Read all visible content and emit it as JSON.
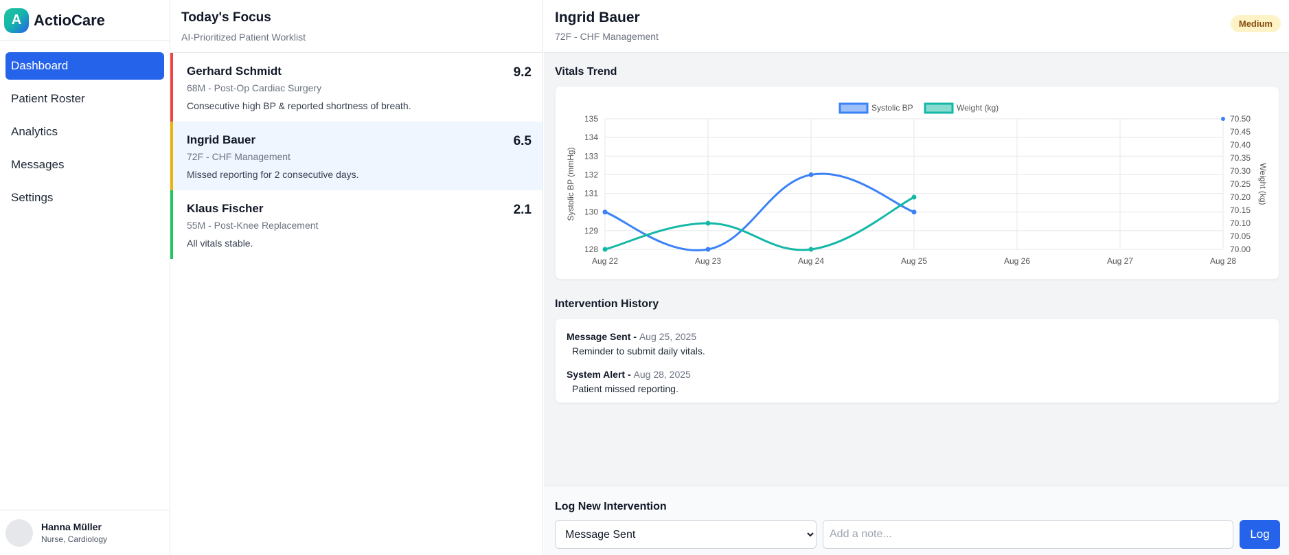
{
  "app": {
    "logo_letter": "A",
    "name": "ActioCare"
  },
  "nav": {
    "items": [
      {
        "label": "Dashboard",
        "active": true
      },
      {
        "label": "Patient Roster",
        "active": false
      },
      {
        "label": "Analytics",
        "active": false
      },
      {
        "label": "Messages",
        "active": false
      },
      {
        "label": "Settings",
        "active": false
      }
    ]
  },
  "user": {
    "name": "Hanna Müller",
    "role": "Nurse, Cardiology"
  },
  "worklist": {
    "title": "Today's Focus",
    "subtitle": "AI-Prioritized Patient Worklist",
    "patients": [
      {
        "name": "Gerhard Schmidt",
        "meta": "68M - Post-Op Cardiac Surgery",
        "note": "Consecutive high BP & reported shortness of breath.",
        "score": "9.2",
        "priority_color": "#ef4444"
      },
      {
        "name": "Ingrid Bauer",
        "meta": "72F - CHF Management",
        "note": "Missed reporting for 2 consecutive days.",
        "score": "6.5",
        "priority_color": "#eab308"
      },
      {
        "name": "Klaus Fischer",
        "meta": "55M - Post-Knee Replacement",
        "note": "All vitals stable.",
        "score": "2.1",
        "priority_color": "#22c55e"
      }
    ]
  },
  "detail": {
    "name": "Ingrid Bauer",
    "meta": "72F - CHF Management",
    "badge": "Medium",
    "vitals_title": "Vitals Trend",
    "history_title": "Intervention History",
    "history": [
      {
        "type": "Message Sent",
        "date": "Aug 25, 2025",
        "note": "Reminder to submit daily vitals."
      },
      {
        "type": "System Alert",
        "date": "Aug 28, 2025",
        "note": "Patient missed reporting."
      }
    ]
  },
  "log": {
    "title": "Log New Intervention",
    "select_value": "Message Sent",
    "note_placeholder": "Add a note...",
    "button_label": "Log"
  },
  "chart_data": {
    "type": "line",
    "categories": [
      "Aug 22",
      "Aug 23",
      "Aug 24",
      "Aug 25",
      "Aug 26",
      "Aug 27",
      "Aug 28"
    ],
    "series": [
      {
        "name": "Systolic BP",
        "axis": "left",
        "color": "#3b82f6",
        "values": [
          130,
          128,
          132,
          130,
          null,
          null,
          null
        ]
      },
      {
        "name": "Weight (kg)",
        "axis": "right",
        "color": "#14b8a6",
        "values": [
          70.0,
          70.1,
          70.0,
          70.2,
          null,
          null,
          null
        ]
      }
    ],
    "ylabel": "Systolic BP (mmHg)",
    "ylim": [
      128,
      135
    ],
    "yticks": [
      "128",
      "129",
      "130",
      "131",
      "132",
      "133",
      "134",
      "135"
    ],
    "y2label": "Weight (kg)",
    "y2lim": [
      70.0,
      70.5
    ],
    "y2ticks": [
      "70.00",
      "70.05",
      "70.10",
      "70.15",
      "70.20",
      "70.25",
      "70.30",
      "70.35",
      "70.40",
      "70.45",
      "70.50"
    ],
    "legend": "top",
    "grid": true
  }
}
